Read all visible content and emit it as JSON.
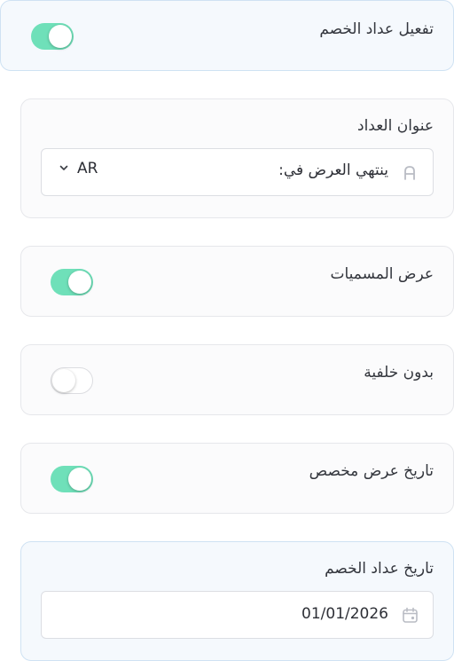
{
  "enable_counter": {
    "label": "تفعيل عداد الخصم",
    "enabled": true
  },
  "counter_title": {
    "label": "عنوان العداد",
    "value": "ينتهي العرض في:",
    "language": "AR",
    "field_icon": "text-format-icon",
    "dropdown_icon": "chevron-down-icon"
  },
  "show_labels": {
    "label": "عرض المسميات",
    "enabled": true
  },
  "no_background": {
    "label": "بدون خلفية",
    "enabled": false
  },
  "custom_display_date": {
    "label": "تاريخ عرض مخصص",
    "enabled": true
  },
  "counter_date": {
    "label": "تاريخ عداد الخصم",
    "value": "01/01/2026",
    "icon": "calendar-icon"
  },
  "colors": {
    "toggle_on": "#6fe0b9",
    "toggle_off": "#ffffff",
    "highlight_card": "#f5f9fd",
    "card": "#fbfbfc"
  }
}
